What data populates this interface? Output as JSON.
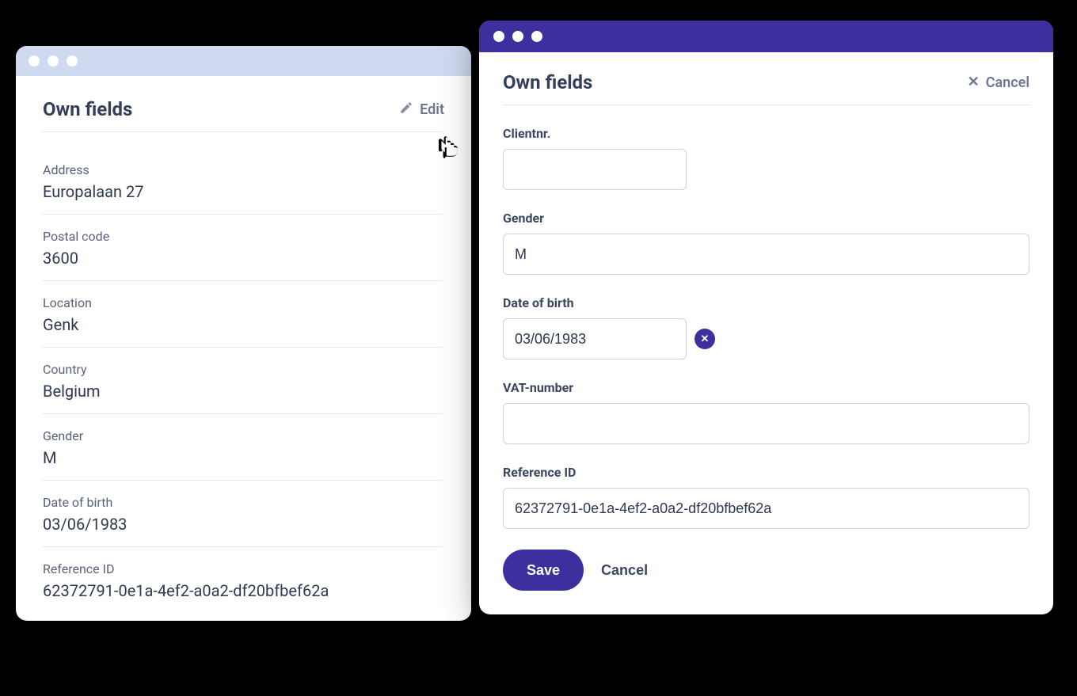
{
  "leftPanel": {
    "title": "Own fields",
    "editLabel": "Edit",
    "fields": [
      {
        "label": "Address",
        "value": "Europalaan 27"
      },
      {
        "label": "Postal code",
        "value": "3600"
      },
      {
        "label": "Location",
        "value": "Genk"
      },
      {
        "label": "Country",
        "value": "Belgium"
      },
      {
        "label": "Gender",
        "value": "M"
      },
      {
        "label": "Date of birth",
        "value": "03/06/1983"
      },
      {
        "label": "Reference ID",
        "value": "62372791-0e1a-4ef2-a0a2-df20bfbef62a"
      }
    ]
  },
  "rightPanel": {
    "title": "Own fields",
    "cancelLabel": "Cancel",
    "form": {
      "clientnr": {
        "label": "Clientnr.",
        "value": ""
      },
      "gender": {
        "label": "Gender",
        "value": "M"
      },
      "dob": {
        "label": "Date of birth",
        "value": "03/06/1983"
      },
      "vat": {
        "label": "VAT-number",
        "value": ""
      },
      "reference": {
        "label": "Reference ID",
        "value": "62372791-0e1a-4ef2-a0a2-df20bfbef62a"
      }
    },
    "saveLabel": "Save",
    "cancelButtonLabel": "Cancel"
  }
}
